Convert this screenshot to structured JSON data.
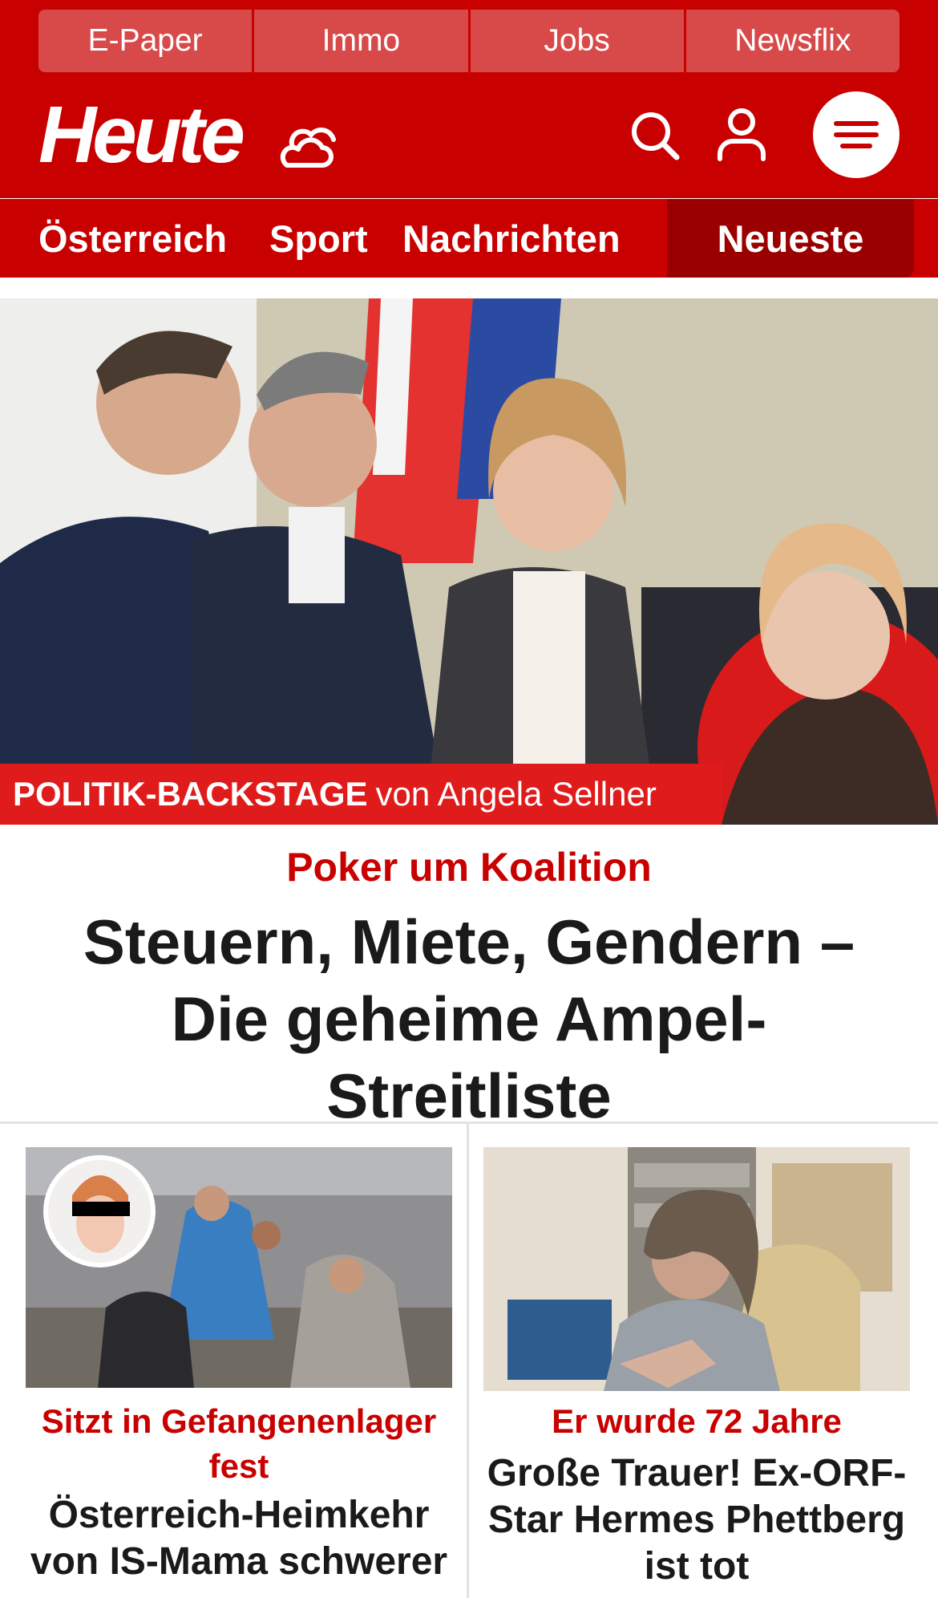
{
  "top_links": [
    "E-Paper",
    "Immo",
    "Jobs",
    "Newsflix"
  ],
  "brand": {
    "logo": "Heute"
  },
  "nav": {
    "items": [
      "Österreich",
      "Sport",
      "Nachrichten"
    ],
    "active": "Neueste"
  },
  "icons": {
    "weather": "weather-cloud-icon",
    "search": "search-icon",
    "account": "user-icon",
    "menu": "menu-icon"
  },
  "colors": {
    "brand_red": "#c90000",
    "banner_red": "#e01b1b",
    "active_tab": "#9b0000",
    "link_tile": "#d84a4a"
  },
  "hero": {
    "banner_bold": "POLITIK-BACKSTAGE",
    "banner_rest": "von Angela Sellner",
    "kicker": "Poker um Koalition",
    "title": "Steuern, Miete, Gendern – Die geheime Ampel-Streitliste"
  },
  "cards": [
    {
      "kicker": "Sitzt in Gefangenenlager fest",
      "title": "Österreich-Heimkehr von IS-Mama schwerer"
    },
    {
      "kicker": "Er wurde 72 Jahre",
      "title": "Große Trauer! Ex-ORF-Star Hermes Phettberg ist tot"
    }
  ]
}
